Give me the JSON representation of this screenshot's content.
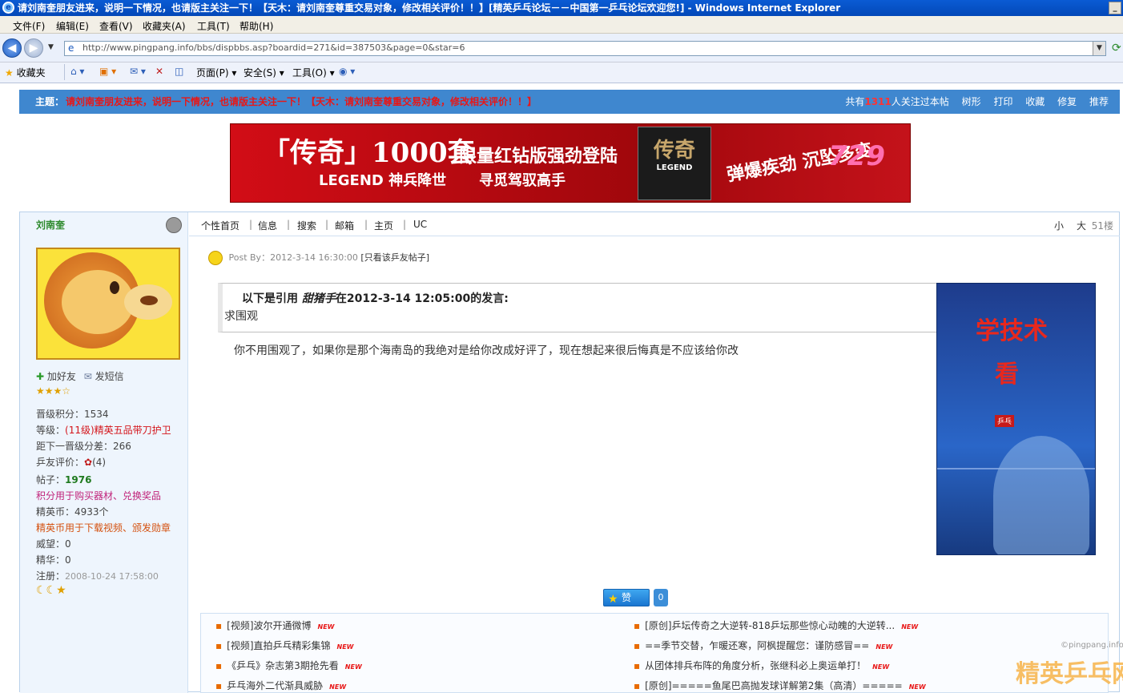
{
  "window": {
    "title": "请刘南奎朋友进来，说明一下情况，也请版主关注一下！【天木：请刘南奎尊重交易对象，修改相关评价！！】[精英乒乓论坛－－中国第一乒乓论坛欢迎您!] - Windows Internet Explorer"
  },
  "menubar": [
    "文件(F)",
    "编辑(E)",
    "查看(V)",
    "收藏夹(A)",
    "工具(T)",
    "帮助(H)"
  ],
  "address": {
    "url": "http://www.pingpang.info/bbs/dispbbs.asp?boardid=271&id=387503&page=0&star=6"
  },
  "commandbar": {
    "favorites": "收藏夹",
    "page": "页面(P)",
    "safety": "安全(S)",
    "tools": "工具(O)"
  },
  "topic_band": {
    "label": "主题：",
    "title": "请刘南奎朋友进来，说明一下情况，也请版主关注一下！【天木：请刘南奎尊重交易对象，修改相关评价！！】",
    "viewers_prefix": "共有",
    "viewers_count": "1311",
    "viewers_suffix": "人关注过本帖",
    "actions": [
      "树形",
      "打印",
      "收藏",
      "修复",
      "推荐"
    ]
  },
  "banner": {
    "t1": "「传奇」1000套",
    "t2": "限量红钻版强劲登陆",
    "t3": "LEGEND 神兵降世",
    "t4": "寻觅驾驭高手",
    "box_title": "传奇",
    "box_sub": "LEGEND",
    "t5": "弹爆疾劲 沉坠多变",
    "t6": "729"
  },
  "user": {
    "name": "刘南奎",
    "add_friend": "加好友",
    "send_msg": "发短信",
    "level_label": "晋级积分：",
    "level_value": "1534",
    "grade_label": "等级：",
    "grade_value": "(11级)精英五品带刀护卫",
    "next_label": "距下一晋级分差：",
    "next_value": "266",
    "eval_label": "乒友评价：",
    "eval_value": "(4)",
    "posts_label": "帖子：",
    "posts_value": "1976",
    "points_note": "积分用于购买器材、兑换奖品",
    "coins_label": "精英币：",
    "coins_value": "4933个",
    "coins_note": "精英币用于下载视频、颁发勋章",
    "prestige_label": "威望：",
    "prestige_value": "0",
    "essence_label": "精华：",
    "essence_value": "0",
    "reg_label": "注册：",
    "reg_value": "2008-10-24 17:58:00"
  },
  "post_nav": {
    "items": [
      "个性首页",
      "信息",
      "搜索",
      "邮箱",
      "主页",
      "UC"
    ],
    "font_small": "小",
    "font_big": "大",
    "floor": "51楼"
  },
  "post": {
    "meta_prefix": "Post By：2012-3-14 16:30:00 ",
    "only_this_user": "[只看该乒友帖子]",
    "quote_prefix": "以下是引用",
    "quote_author": "甜猪手",
    "quote_suffix": "在2012-3-14 12:05:00的发言:",
    "quote_body": "求围观",
    "reply": "你不用围观了，如果你是那个海南岛的我绝对是给你改成好评了，现在想起来很后悔真是不应该给你改",
    "like_label": "赞",
    "like_count": "0"
  },
  "ad": {
    "line1": "学技术",
    "line2": "看",
    "logo": "乒乓"
  },
  "links": {
    "left": [
      "[视频]波尔开通微博",
      "[视频]直拍乒乓精彩集锦",
      "《乒乓》杂志第3期抢先看",
      "乒乓海外二代渐具威胁"
    ],
    "right": [
      "[原创]乒坛传奇之大逆转-818乒坛那些惊心动魄的大逆转...",
      "==季节交替，乍暖还寒，阿枫提醒您：谨防感冒==",
      "从团体排兵布阵的角度分析，张继科必上奥运单打！",
      "[原创]=====鱼尾巴高抛发球详解第2集（高清）====="
    ],
    "new_tag": "NEW"
  },
  "watermark": {
    "url": "©pingpang.info",
    "brand": "精英乒乓网"
  }
}
